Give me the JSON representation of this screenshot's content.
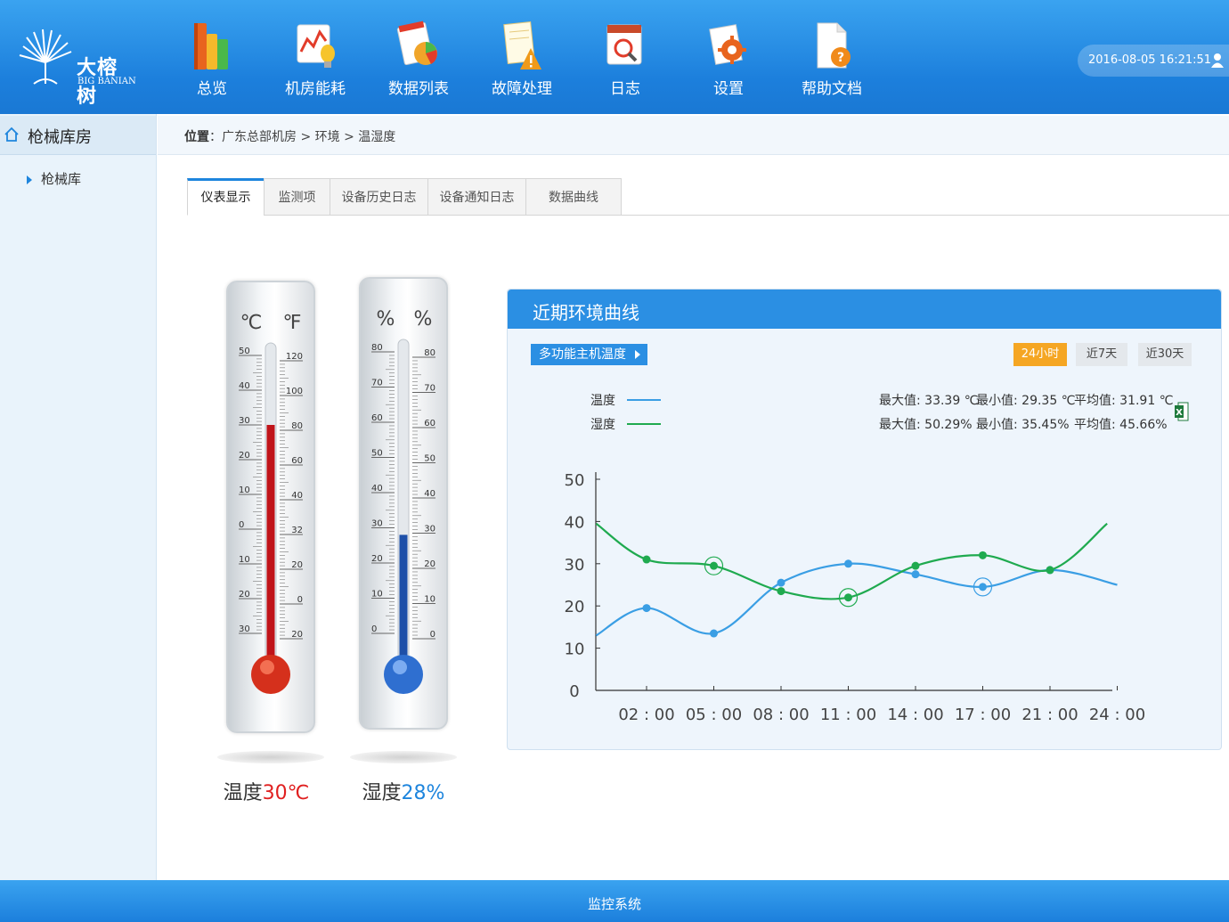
{
  "brand": {
    "name": "大榕树",
    "sub": "BIG BANIAN"
  },
  "nav": [
    {
      "label": "总览",
      "icon": "overview-books-icon"
    },
    {
      "label": "机房能耗",
      "icon": "energy-chart-icon"
    },
    {
      "label": "数据列表",
      "icon": "data-list-icon"
    },
    {
      "label": "故障处理",
      "icon": "fault-warning-icon"
    },
    {
      "label": "日志",
      "icon": "log-calendar-icon"
    },
    {
      "label": "设置",
      "icon": "settings-gear-icon"
    },
    {
      "label": "帮助文档",
      "icon": "help-doc-icon"
    }
  ],
  "datetime": "2016-08-05 16:21:51",
  "sidebar": {
    "title": "枪械库房",
    "items": [
      {
        "label": "枪械库"
      }
    ]
  },
  "breadcrumb": {
    "prefix": "位置",
    "path": "：广东总部机房 > 环境 > 温湿度"
  },
  "tabs": [
    {
      "label": "仪表显示",
      "active": true
    },
    {
      "label": "监测项",
      "active": false
    },
    {
      "label": "设备历史日志",
      "active": false
    },
    {
      "label": "设备通知日志",
      "active": false
    },
    {
      "label": "数据曲线",
      "active": false
    }
  ],
  "thermo": {
    "celsius_unit": "℃",
    "fahrenheit_unit": "℉",
    "celsius_ticks": [
      "50",
      "40",
      "30",
      "20",
      "10",
      "0",
      "10",
      "20",
      "30"
    ],
    "fahrenheit_ticks": [
      "120",
      "100",
      "80",
      "60",
      "40",
      "32",
      "20",
      "0",
      "20"
    ],
    "level": 0.3,
    "caption_label": "温度",
    "caption_value": "30℃"
  },
  "hygro": {
    "left_unit": "%",
    "right_unit": "%",
    "ticks": [
      "80",
      "70",
      "60",
      "50",
      "40",
      "30",
      "20",
      "10",
      "0"
    ],
    "level": 0.28,
    "caption_label": "湿度",
    "caption_value": "28%"
  },
  "panel": {
    "title": "近期环境曲线",
    "series_select": "多功能主机温度",
    "ranges": [
      {
        "label": "24小时",
        "active": true
      },
      {
        "label": "近7天",
        "active": false
      },
      {
        "label": "近30天",
        "active": false
      }
    ],
    "legend": [
      {
        "label": "温度",
        "color": "#3a9ee4"
      },
      {
        "label": "湿度",
        "color": "#1faa4f"
      }
    ],
    "stats": {
      "temp_max": "最大值: 33.39 ℃",
      "temp_min": "最小值: 29.35 ℃",
      "temp_avg": "平均值: 31.91 ℃",
      "hum_max": "最大值: 50.29%",
      "hum_min": "最小值: 35.45%",
      "hum_avg": "平均值: 45.66%"
    }
  },
  "chart_data": {
    "type": "line",
    "categories": [
      "02 : 00",
      "05 : 00",
      "08 : 00",
      "11 : 00",
      "14 : 00",
      "17 : 00",
      "21 : 00",
      "24 : 00"
    ],
    "yticks": [
      "50",
      "40",
      "30",
      "20",
      "10",
      "0"
    ],
    "ylim": [
      0,
      50
    ],
    "series": [
      {
        "name": "温度",
        "color": "#3a9ee4",
        "x": [
          -0.75,
          0,
          1,
          2,
          3,
          4,
          5,
          6,
          7
        ],
        "values": [
          13,
          19.5,
          13.5,
          25.5,
          30,
          27.5,
          24.5,
          28.5,
          25
        ]
      },
      {
        "name": "湿度",
        "color": "#1faa4f",
        "x": [
          -0.75,
          0,
          1,
          2,
          3,
          4,
          5,
          6,
          6.85
        ],
        "values": [
          39.5,
          31,
          29.5,
          23.5,
          22,
          29.5,
          32,
          28.5,
          39.5
        ]
      }
    ],
    "grid": false,
    "legend": "top-left"
  },
  "footer": "监控系统"
}
